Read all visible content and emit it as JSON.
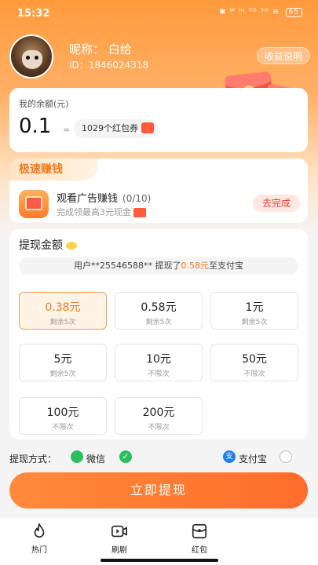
{
  "status_bar": {
    "time": "15:32",
    "icons": "✱ ᵂ ⁿᶦ ⁵ᴳ ⁵ᴳ ≋",
    "battery": "65"
  },
  "profile": {
    "nickname": "昵称：  白给",
    "uid": "ID：1846024318",
    "income_button": "收益说明"
  },
  "balance": {
    "title": "我的余额(元)",
    "value": "0.1",
    "approx": "≈",
    "coupon_text": "1029个红包券"
  },
  "speed_earn": {
    "tag": "极速赚钱",
    "task_title": "观看广告赚钱",
    "task_count": "(0/10)",
    "task_subtitle": "完成领最高3元现金",
    "button": "去完成"
  },
  "withdraw": {
    "title": "提现金额",
    "notice_prefix": "用户**25546588** 提现了",
    "notice_amount": "0.58元",
    "notice_suffix": "至支付宝",
    "amounts": [
      {
        "value": "0.38元",
        "sub": "剩余5次",
        "selected": true
      },
      {
        "value": "0.58元",
        "sub": "剩余5次",
        "selected": false
      },
      {
        "value": "1元",
        "sub": "剩余5次",
        "selected": false
      },
      {
        "value": "5元",
        "sub": "剩余5次",
        "selected": false
      },
      {
        "value": "10元",
        "sub": "不限次",
        "selected": false
      },
      {
        "value": "50元",
        "sub": "不限次",
        "selected": false
      },
      {
        "value": "100元",
        "sub": "不限次",
        "selected": false
      },
      {
        "value": "200元",
        "sub": "不限次",
        "selected": false
      }
    ]
  },
  "payment": {
    "label": "提现方式：",
    "wechat": "微信",
    "alipay": "支付宝",
    "alipay_glyph": "支",
    "check": "✓",
    "selected": "wechat"
  },
  "submit_button": "立即提现",
  "nav": [
    {
      "label": "热门",
      "icon": "flame-icon"
    },
    {
      "label": "刷剧",
      "icon": "video-icon"
    },
    {
      "label": "红包",
      "icon": "red-packet-icon"
    }
  ],
  "colors": {
    "accent": "#ff8a3c",
    "wechat": "#2bbd5f",
    "alipay": "#1e7ff5"
  }
}
